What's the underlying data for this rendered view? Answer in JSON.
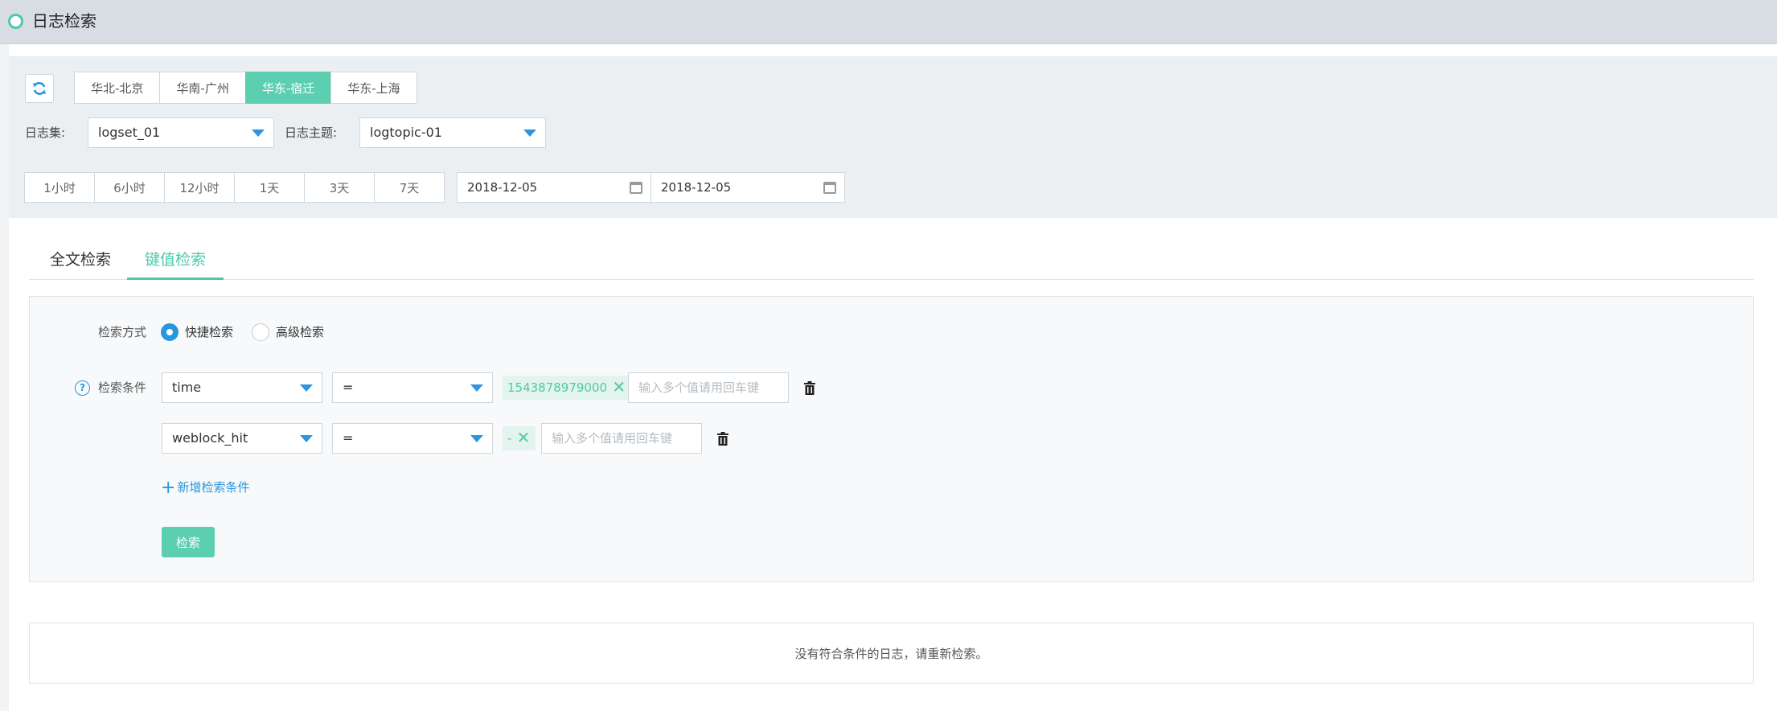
{
  "header": {
    "title": "日志检索"
  },
  "regions": [
    {
      "label": "华北-北京",
      "active": false
    },
    {
      "label": "华南-广州",
      "active": false
    },
    {
      "label": "华东-宿迁",
      "active": true
    },
    {
      "label": "华东-上海",
      "active": false
    }
  ],
  "filters": {
    "logset_label": "日志集:",
    "logset_value": "logset_01",
    "logtopic_label": "日志主题:",
    "logtopic_value": "logtopic-01"
  },
  "time_ranges": [
    "1小时",
    "6小时",
    "12小时",
    "1天",
    "3天",
    "7天"
  ],
  "dates": {
    "start": "2018-12-05",
    "end": "2018-12-05"
  },
  "tabs": [
    {
      "label": "全文检索",
      "active": false
    },
    {
      "label": "键值检索",
      "active": true
    }
  ],
  "query": {
    "mode_label": "检索方式",
    "mode_options": [
      {
        "label": "快捷检索",
        "checked": true
      },
      {
        "label": "高级检索",
        "checked": false
      }
    ],
    "cond_label": "检索条件",
    "conditions": [
      {
        "field": "time",
        "operator": "=",
        "tag": "1543878979000",
        "placeholder": "输入多个值请用回车键"
      },
      {
        "field": "weblock_hit",
        "operator": "=",
        "tag": "-",
        "placeholder": "输入多个值请用回车键"
      }
    ],
    "add_label": "新增检索条件",
    "search_label": "检索"
  },
  "result": {
    "empty_text": "没有符合条件的日志，请重新检索。"
  },
  "colors": {
    "accent": "#5bcfb0",
    "link": "#2b96dd",
    "header_bg": "#d7dde2",
    "panel_bg": "#ebeff2"
  },
  "icons": [
    "refresh-icon",
    "caret-down-icon",
    "calendar-icon",
    "help-icon",
    "close-icon",
    "trash-icon",
    "plus-icon"
  ]
}
